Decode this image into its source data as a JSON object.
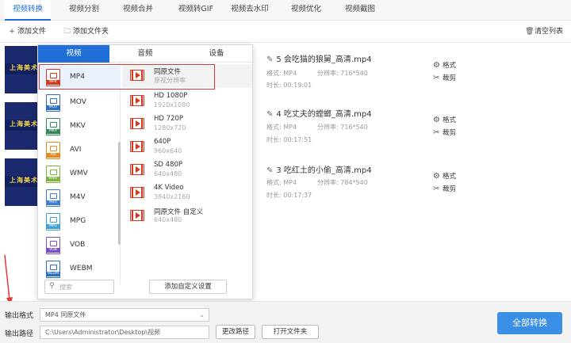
{
  "top_tabs": [
    "视频转换",
    "视频分割",
    "视频合并",
    "视频转GIF",
    "视频去水印",
    "视频优化",
    "视频截图"
  ],
  "toolbar": {
    "add_file": "添加文件",
    "add_folder": "添加文件夹",
    "clear_list": "清空列表"
  },
  "files": [
    {
      "name": "5 会吃猫的狼舅_高清.mp4",
      "format_label": "格式:",
      "format": "MP4",
      "res_label": "分辨率:",
      "resolution": "716*540",
      "duration_label": "时长:",
      "duration": "00:19:01",
      "thumb_text": "上海美术"
    },
    {
      "name": "4 吃丈夫的螳螂_高清.mp4",
      "format_label": "格式:",
      "format": "MP4",
      "res_label": "分辨率:",
      "resolution": "716*540",
      "duration_label": "时长:",
      "duration": "00:17:51",
      "thumb_text": "上海美术"
    },
    {
      "name": "3 吃红土的小偷_高清.mp4",
      "format_label": "格式:",
      "format": "MP4",
      "res_label": "分辨率:",
      "resolution": "784*540",
      "duration_label": "时长:",
      "duration": "00:17:37",
      "thumb_text": "上海美术"
    }
  ],
  "file_actions": {
    "format": "格式",
    "crop": "裁剪"
  },
  "popup": {
    "tabs": [
      "视频",
      "音频",
      "设备"
    ],
    "formats": [
      {
        "name": "MP4",
        "color": "#d9361e"
      },
      {
        "name": "MOV",
        "color": "#2b6cc4"
      },
      {
        "name": "MKV",
        "color": "#2e8b57"
      },
      {
        "name": "AVI",
        "color": "#e58a1f"
      },
      {
        "name": "WMV",
        "color": "#7bb33a"
      },
      {
        "name": "M4V",
        "color": "#3a7bd5"
      },
      {
        "name": "MPG",
        "color": "#3aa0d5"
      },
      {
        "name": "VOB",
        "color": "#7a4fc9"
      },
      {
        "name": "WEBM",
        "color": "#2b6cc4"
      }
    ],
    "qualities": [
      {
        "title": "同原文件",
        "sub": "原视分辨率"
      },
      {
        "title": "HD 1080P",
        "sub": "1920x1080"
      },
      {
        "title": "HD 720P",
        "sub": "1280x720"
      },
      {
        "title": "640P",
        "sub": "960x640"
      },
      {
        "title": "SD 480P",
        "sub": "640x480"
      },
      {
        "title": "4K Video",
        "sub": "3840x2160"
      },
      {
        "title": "同原文件 自定义",
        "sub": "640x480"
      }
    ],
    "search_placeholder": "搜索",
    "add_custom": "添加自定义设置"
  },
  "bottom": {
    "output_format_label": "输出格式",
    "output_format_value": "MP4  同原文件",
    "output_path_label": "输出路径",
    "output_path_value": "C:\\Users\\Administrator\\Desktop\\视频",
    "change_path": "更改路径",
    "open_folder": "打开文件夹",
    "convert_all": "全部转换"
  },
  "colors": {
    "accent": "#1f6fd6",
    "convert": "#3a8ee6",
    "highlight": "#e23a3a"
  }
}
